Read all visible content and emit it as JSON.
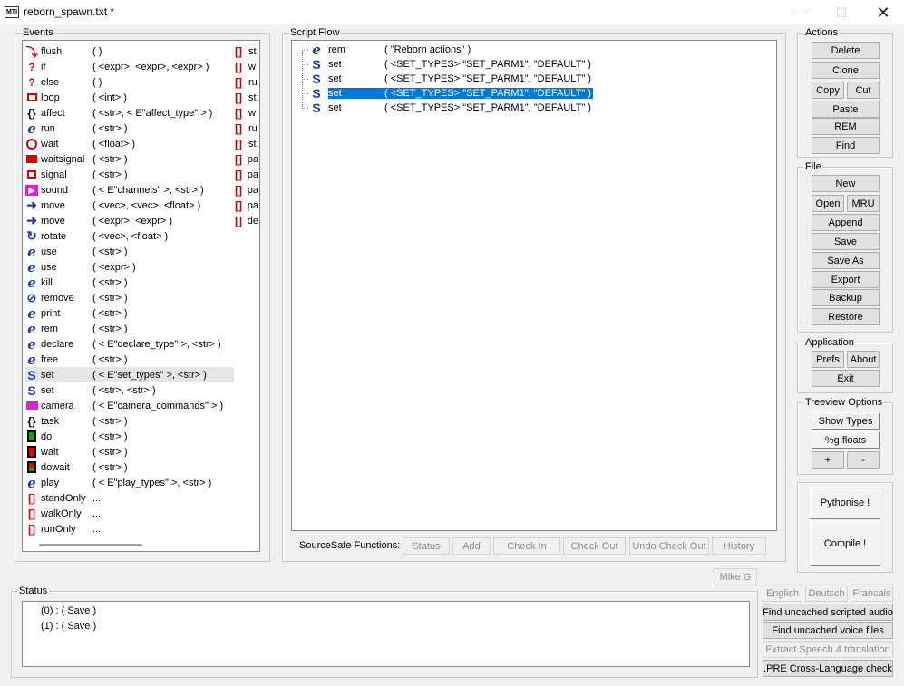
{
  "window": {
    "title": "reborn_spawn.txt *",
    "icon_label": "MTI"
  },
  "events": {
    "label": "Events",
    "items": [
      {
        "name": "flush",
        "args": "(   )",
        "icon": "flush-icon"
      },
      {
        "name": "if",
        "args": "( <expr>, <expr>, <expr> )",
        "icon": "if-icon"
      },
      {
        "name": "else",
        "args": "(   )",
        "icon": "else-icon"
      },
      {
        "name": "loop",
        "args": "( <int> )",
        "icon": "loop-icon"
      },
      {
        "name": "affect",
        "args": "( <str>, < E\"affect_type\" > )",
        "icon": "braces-icon"
      },
      {
        "name": "run",
        "args": "( <str> )",
        "icon": "e-icon"
      },
      {
        "name": "wait",
        "args": "( <float> )",
        "icon": "clock-icon"
      },
      {
        "name": "waitsignal",
        "args": "( <str> )",
        "icon": "waitsignal-icon"
      },
      {
        "name": "signal",
        "args": "( <str> )",
        "icon": "signal-icon"
      },
      {
        "name": "sound",
        "args": "( < E\"channels\" >, <str> )",
        "icon": "sound-icon"
      },
      {
        "name": "move",
        "args": "( <vec>, <vec>, <float> )",
        "icon": "arrow-icon"
      },
      {
        "name": "move",
        "args": "( <expr>, <expr> )",
        "icon": "arrow-icon"
      },
      {
        "name": "rotate",
        "args": "( <vec>, <float> )",
        "icon": "rotate-icon"
      },
      {
        "name": "use",
        "args": "( <str> )",
        "icon": "e-icon"
      },
      {
        "name": "use",
        "args": "( <expr> )",
        "icon": "e-icon"
      },
      {
        "name": "kill",
        "args": "( <str> )",
        "icon": "e-icon"
      },
      {
        "name": "remove",
        "args": "( <str> )",
        "icon": "remove-icon"
      },
      {
        "name": "print",
        "args": "( <str> )",
        "icon": "e-icon"
      },
      {
        "name": "rem",
        "args": "( <str> )",
        "icon": "e-icon"
      },
      {
        "name": "declare",
        "args": "( < E\"declare_type\" >, <str> )",
        "icon": "e-icon"
      },
      {
        "name": "free",
        "args": "( <str> )",
        "icon": "e-icon"
      },
      {
        "name": "set",
        "args": "( < E\"set_types\" >, <str> )",
        "icon": "s-icon"
      },
      {
        "name": "set",
        "args": "( <str>, <str> )",
        "icon": "s-icon"
      },
      {
        "name": "camera",
        "args": "( < E\"camera_commands\" > )",
        "icon": "camera-icon"
      },
      {
        "name": "task",
        "args": "( <str> )",
        "icon": "braces-icon"
      },
      {
        "name": "do",
        "args": "( <str> )",
        "icon": "do-icon"
      },
      {
        "name": "wait",
        "args": "( <str> )",
        "icon": "wait-red-icon"
      },
      {
        "name": "dowait",
        "args": "( <str> )",
        "icon": "dowait-icon"
      },
      {
        "name": "play",
        "args": "( < E\"play_types\" >, <str> )",
        "icon": "e-icon"
      },
      {
        "name": "standOnly",
        "args": "...",
        "icon": "brackets-icon"
      },
      {
        "name": "walkOnly",
        "args": "...",
        "icon": "brackets-icon"
      },
      {
        "name": "runOnly",
        "args": "...",
        "icon": "brackets-icon"
      }
    ],
    "col2": [
      "st",
      "w",
      "ru",
      "st",
      "w",
      "ru",
      "st",
      "pa",
      "pa",
      "pa",
      "pa",
      "de"
    ]
  },
  "flow": {
    "label": "Script Flow",
    "items": [
      {
        "name": "rem",
        "args": "( \"Reborn actions\" )",
        "icon": "e-icon"
      },
      {
        "name": "set",
        "args": "( <SET_TYPES> \"SET_PARM1\", \"DEFAULT\" )",
        "icon": "s-icon"
      },
      {
        "name": "set",
        "args": "( <SET_TYPES> \"SET_PARM1\", \"DEFAULT\" )",
        "icon": "s-icon"
      },
      {
        "name": "set",
        "args": "( <SET_TYPES> \"SET_PARM1\", \"DEFAULT\" )",
        "icon": "s-icon"
      },
      {
        "name": "set",
        "args": "( <SET_TYPES> \"SET_PARM1\", \"DEFAULT\" )",
        "icon": "s-icon"
      }
    ],
    "sourcesafe_label": "SourceSafe Functions:",
    "ss_buttons": [
      "Status",
      "Add",
      "Check In",
      "Check Out",
      "Undo Check Out",
      "History"
    ]
  },
  "actions": {
    "label": "Actions",
    "delete": "Delete",
    "clone": "Clone",
    "copy": "Copy",
    "cut": "Cut",
    "paste": "Paste",
    "rem": "REM",
    "find": "Find"
  },
  "file": {
    "label": "File",
    "new": "New",
    "open": "Open",
    "mru": "MRU",
    "append": "Append",
    "save": "Save",
    "save_as": "Save As",
    "export": "Export",
    "backup": "Backup",
    "restore": "Restore"
  },
  "application": {
    "label": "Application",
    "prefs": "Prefs",
    "about": "About",
    "exit": "Exit"
  },
  "treeview": {
    "label": "Treeview Options",
    "show_types": "Show Types",
    "floats": "%g floats",
    "plus": "+",
    "minus": "-"
  },
  "big_buttons": {
    "pythonise": "Pythonise !",
    "compile": "Compile !"
  },
  "user": "Mike G",
  "status": {
    "label": "Status",
    "lines": [
      "(0) : ( Save )",
      "(1) : ( Save )"
    ]
  },
  "lang": {
    "english": "English",
    "deutsch": "Deutsch",
    "francais": "Francais"
  },
  "tools": {
    "find_audio": "Find uncached scripted audio",
    "find_voice": "Find uncached voice files",
    "extract": "Extract Speech 4 translation",
    "pre_check": ".PRE Cross-Language check"
  }
}
